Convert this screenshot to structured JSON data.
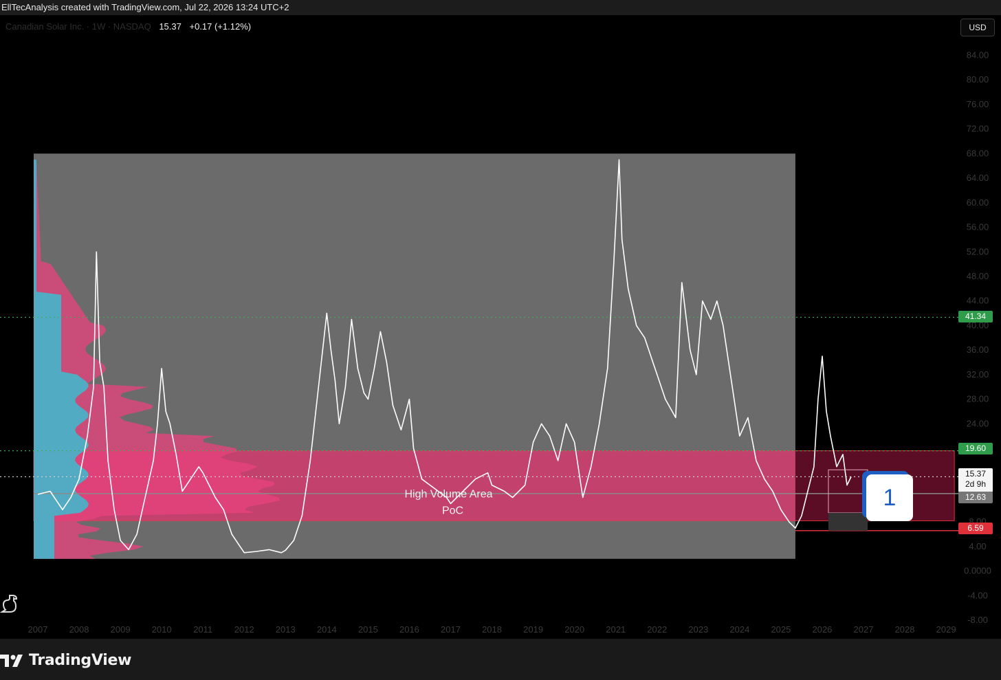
{
  "header": {
    "attribution": "EllTecAnalysis created with TradingView.com, Jul 22, 2026 13:24 UTC+2"
  },
  "legend": {
    "symbol": "Canadian Solar Inc. · 1W · NASDAQ",
    "price": "15.37",
    "change": "+0.17 (+1.12%)"
  },
  "currency_button": "USD",
  "price_tags": {
    "level_upper": "41.34",
    "level_vah": "19.60",
    "current_price": "15.37",
    "countdown": "2d 9h",
    "poc": "12.63",
    "level_low": "6.59"
  },
  "badge": {
    "label": "1"
  },
  "footer": {
    "brand": "TradingView"
  },
  "colors": {
    "background": "#000000",
    "range_box": "#6b6b6b",
    "high_volume_area": "#d64b7a",
    "high_volume_area_right": "#5a0d24",
    "volume_profile_pink": "#e8437c",
    "volume_profile_cyan": "#3bbcd0",
    "price_line": "#ffffff",
    "green_level": "#2e9c4a",
    "red_level": "#e0313a",
    "poc_line": "#8a8a8a"
  },
  "chart_data": {
    "type": "line",
    "x_axis": {
      "labels": [
        "2007",
        "2008",
        "2009",
        "2010",
        "2011",
        "2012",
        "2013",
        "2014",
        "2015",
        "2016",
        "2017",
        "2018",
        "2019",
        "2020",
        "2021",
        "2022",
        "2023",
        "2024",
        "2025",
        "2026",
        "2027",
        "2028",
        "2029"
      ],
      "range": [
        2006.9,
        2029.4
      ]
    },
    "y_axis": {
      "labels": [
        "84.00",
        "80.00",
        "76.00",
        "72.00",
        "68.00",
        "64.00",
        "60.00",
        "56.00",
        "52.00",
        "48.00",
        "44.00",
        "40.00",
        "36.00",
        "32.00",
        "28.00",
        "24.00",
        "20.00",
        "16.00",
        "12.00",
        "8.00",
        "4.00",
        "0.0000",
        "-4.00",
        "-8.00"
      ],
      "range": [
        -8,
        84
      ]
    },
    "series": [
      {
        "points": [
          [
            2007.0,
            12.5
          ],
          [
            2007.3,
            13
          ],
          [
            2007.6,
            10
          ],
          [
            2007.8,
            12
          ],
          [
            2008.0,
            15
          ],
          [
            2008.2,
            22
          ],
          [
            2008.35,
            30
          ],
          [
            2008.42,
            52
          ],
          [
            2008.5,
            34
          ],
          [
            2008.6,
            30
          ],
          [
            2008.7,
            18
          ],
          [
            2008.85,
            10
          ],
          [
            2009.0,
            5
          ],
          [
            2009.2,
            3.5
          ],
          [
            2009.4,
            6
          ],
          [
            2009.6,
            12
          ],
          [
            2009.8,
            18
          ],
          [
            2009.9,
            24
          ],
          [
            2010.0,
            33
          ],
          [
            2010.1,
            26
          ],
          [
            2010.2,
            24
          ],
          [
            2010.35,
            19
          ],
          [
            2010.5,
            13
          ],
          [
            2010.7,
            15
          ],
          [
            2010.9,
            17
          ],
          [
            2011.0,
            16
          ],
          [
            2011.15,
            14
          ],
          [
            2011.3,
            12
          ],
          [
            2011.5,
            10
          ],
          [
            2011.7,
            6
          ],
          [
            2011.9,
            4
          ],
          [
            2012.0,
            3
          ],
          [
            2012.3,
            3.2
          ],
          [
            2012.6,
            3.5
          ],
          [
            2012.9,
            3
          ],
          [
            2013.0,
            3.4
          ],
          [
            2013.2,
            5
          ],
          [
            2013.4,
            9
          ],
          [
            2013.6,
            18
          ],
          [
            2013.8,
            30
          ],
          [
            2014.0,
            42
          ],
          [
            2014.1,
            36
          ],
          [
            2014.2,
            31
          ],
          [
            2014.3,
            24
          ],
          [
            2014.45,
            30
          ],
          [
            2014.6,
            41
          ],
          [
            2014.75,
            33
          ],
          [
            2014.9,
            29
          ],
          [
            2015.0,
            28
          ],
          [
            2015.15,
            33
          ],
          [
            2015.3,
            39
          ],
          [
            2015.45,
            34
          ],
          [
            2015.6,
            27
          ],
          [
            2015.8,
            23
          ],
          [
            2016.0,
            28
          ],
          [
            2016.1,
            20
          ],
          [
            2016.3,
            15
          ],
          [
            2016.5,
            14
          ],
          [
            2016.7,
            13
          ],
          [
            2016.9,
            12
          ],
          [
            2017.0,
            11
          ],
          [
            2017.3,
            13
          ],
          [
            2017.6,
            15
          ],
          [
            2017.9,
            16
          ],
          [
            2018.0,
            14
          ],
          [
            2018.3,
            13
          ],
          [
            2018.5,
            12
          ],
          [
            2018.8,
            14
          ],
          [
            2019.0,
            21
          ],
          [
            2019.2,
            24
          ],
          [
            2019.4,
            22
          ],
          [
            2019.6,
            18
          ],
          [
            2019.8,
            24
          ],
          [
            2020.0,
            21
          ],
          [
            2020.2,
            12
          ],
          [
            2020.4,
            17
          ],
          [
            2020.6,
            24
          ],
          [
            2020.8,
            33
          ],
          [
            2020.95,
            50
          ],
          [
            2021.08,
            67
          ],
          [
            2021.15,
            54
          ],
          [
            2021.3,
            46
          ],
          [
            2021.5,
            40
          ],
          [
            2021.7,
            38
          ],
          [
            2021.9,
            34
          ],
          [
            2022.0,
            32
          ],
          [
            2022.2,
            28
          ],
          [
            2022.45,
            25
          ],
          [
            2022.6,
            47
          ],
          [
            2022.8,
            36
          ],
          [
            2022.95,
            32
          ],
          [
            2023.1,
            44
          ],
          [
            2023.3,
            41
          ],
          [
            2023.45,
            44
          ],
          [
            2023.6,
            40
          ],
          [
            2023.8,
            31
          ],
          [
            2024.0,
            22
          ],
          [
            2024.2,
            25
          ],
          [
            2024.4,
            18
          ],
          [
            2024.6,
            15
          ],
          [
            2024.8,
            13
          ],
          [
            2025.0,
            10
          ],
          [
            2025.2,
            8
          ],
          [
            2025.35,
            7
          ],
          [
            2025.5,
            9
          ],
          [
            2025.65,
            13
          ],
          [
            2025.8,
            17
          ],
          [
            2025.9,
            28
          ],
          [
            2026.0,
            35
          ],
          [
            2026.1,
            26
          ],
          [
            2026.2,
            22
          ],
          [
            2026.35,
            17
          ],
          [
            2026.5,
            19
          ],
          [
            2026.6,
            14
          ],
          [
            2026.7,
            15.37
          ]
        ]
      }
    ],
    "range_box": {
      "x": [
        2006.9,
        2025.35
      ],
      "y": [
        2,
        68
      ]
    },
    "high_volume_area": {
      "x": [
        2006.9,
        2029.2
      ],
      "y": [
        8.2,
        19.6
      ],
      "label": "High Volume Area"
    },
    "poc": {
      "value": 12.63,
      "label": "PoC"
    },
    "levels": [
      {
        "value": 41.34,
        "style": "dotted",
        "color": "green"
      },
      {
        "value": 19.6,
        "style": "dotted",
        "color": "green"
      },
      {
        "value": 15.37,
        "style": "dotted",
        "color": "white"
      },
      {
        "value": 6.59,
        "style": "solid",
        "color": "red"
      }
    ],
    "grid": false
  }
}
